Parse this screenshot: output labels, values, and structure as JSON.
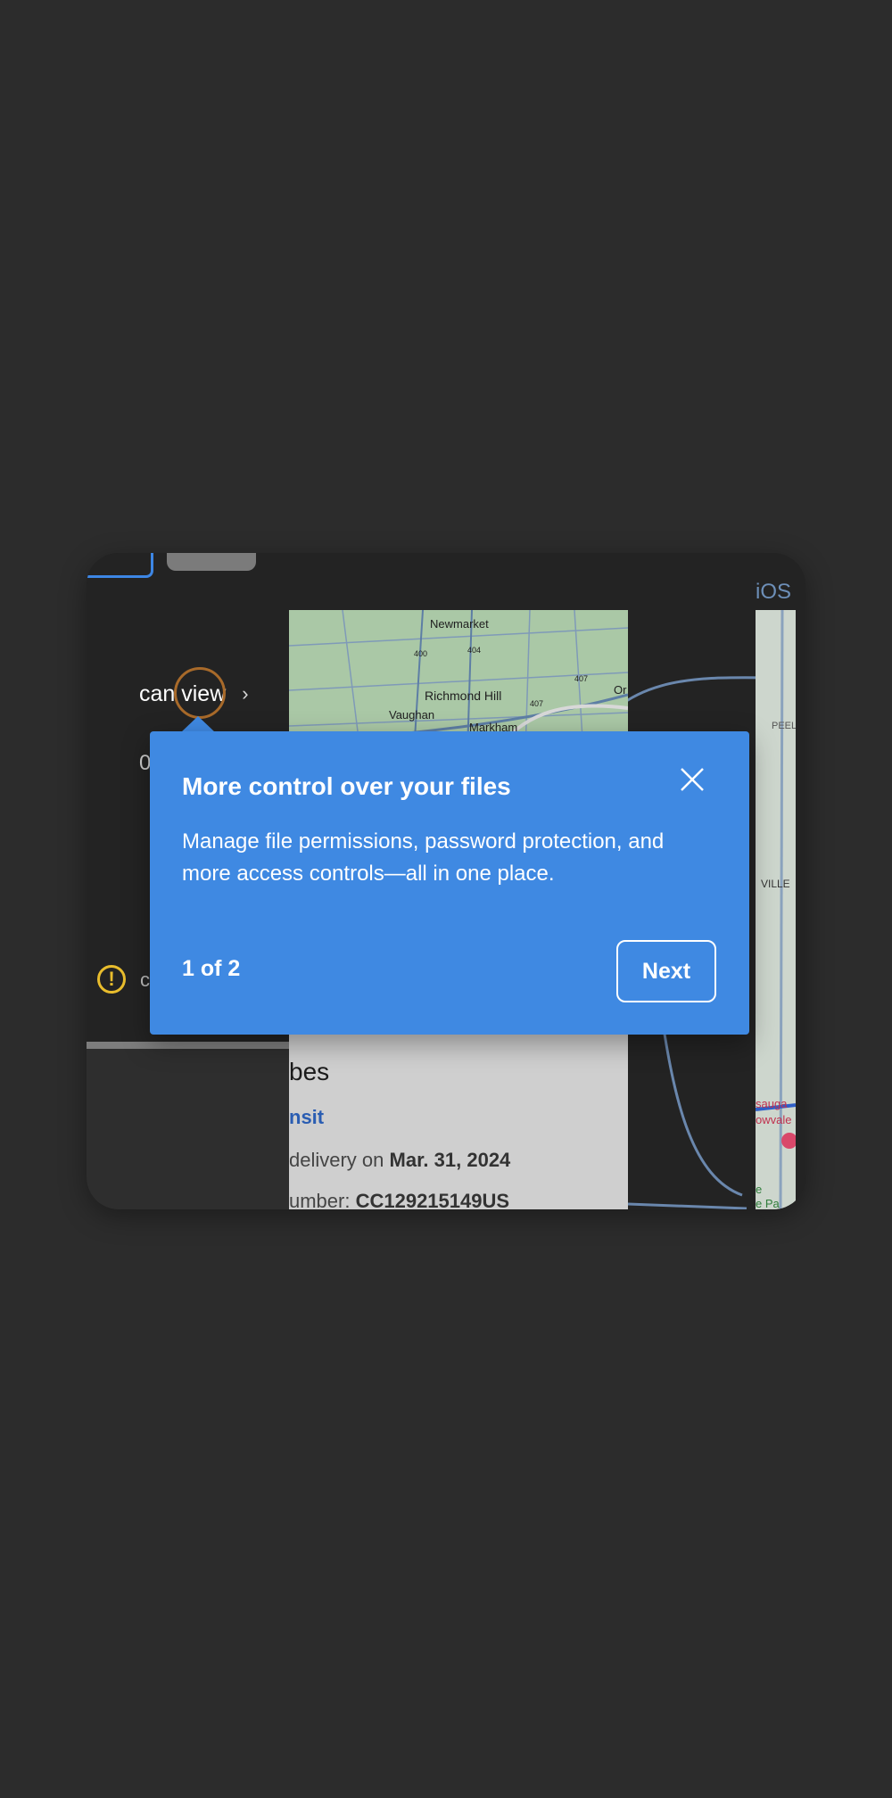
{
  "sidebar": {
    "permission_label": "can view",
    "partial_label": "0",
    "warning_partial": "c"
  },
  "map": {
    "labels": [
      "Newmarket",
      "Richmond Hill",
      "Vaughan",
      "Markham",
      "Or",
      "400",
      "404",
      "407",
      "407"
    ]
  },
  "content": {
    "title_partial": "bes",
    "status_link": "nsit",
    "delivery_prefix": "delivery on ",
    "delivery_date": "Mar. 31, 2024",
    "tracking_prefix": "umber: ",
    "tracking_number": "CC129215149US"
  },
  "right_panel": {
    "platform_label": "iOS",
    "map_labels": [
      "PEEL",
      "VILLE",
      "sauga",
      "owvale",
      "e",
      "e Pa"
    ]
  },
  "popover": {
    "title": "More control over your files",
    "body": "Manage file permissions, password protection, and more access controls—all in one place.",
    "step": "1 of 2",
    "next_label": "Next"
  },
  "colors": {
    "popover_bg": "#3f89e2",
    "warning": "#e9bd2d",
    "focus_ring": "#a86a2a",
    "background": "#2c2c2c"
  }
}
